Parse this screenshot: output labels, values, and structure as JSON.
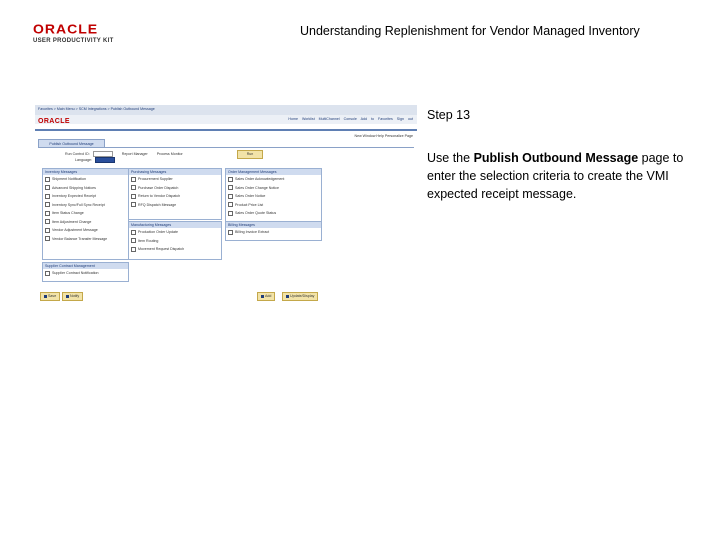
{
  "header": {
    "logo_oracle": "ORACLE",
    "logo_upk": "USER PRODUCTIVITY KIT",
    "title": "Understanding Replenishment for Vendor Managed Inventory"
  },
  "step": {
    "label": "Step 13"
  },
  "instruction": {
    "prefix": "Use the ",
    "bold": "Publish Outbound Message",
    "suffix": " page to enter the selection criteria to create the VMI expected receipt message."
  },
  "screenshot": {
    "breadcrumb": "Favorites  >  Main Menu  >  SCM Integrations  >  Publish Outbound Message",
    "nav_links": "Home   Worklist   MultiChannel Console   Add to Favorites   Sign out",
    "logo": "ORACLE",
    "util_links": "New Window  Help  Personalize Page",
    "tab_label": "Publish Outbound Message",
    "run_control_label": "Run Control ID:",
    "run_control_value": "1",
    "language_label": "Language:",
    "report_manager": "Report Manager",
    "process_monitor": "Process Monitor",
    "run_button": "Run",
    "boxes": {
      "inventory": {
        "header": "Inventory Messages",
        "items": [
          "Shipment Notification",
          "Advanced Shipping Notices",
          "Inventory Expected Receipt",
          "Inventory Sync/Full Sync Receipt",
          "Item Status Change",
          "Item Adjustment Change",
          "Vendor Adjustment Message",
          "Vendor Balance Transfer Message"
        ]
      },
      "purchasing": {
        "header": "Purchasing Messages",
        "items": [
          "Procurement Supplier",
          "Purchase Order Dispatch",
          "Return to Vendor Dispatch",
          "RFQ Dispatch Message"
        ]
      },
      "order": {
        "header": "Order Management Messages",
        "items": [
          "Sales Order Acknowledgement",
          "Sales Order Change Notice",
          "Sales Order Notice",
          "Product Price List",
          "Sales Order Quote Status"
        ]
      },
      "manufacturing": {
        "header": "Manufacturing Messages",
        "items": [
          "Production Order Update",
          "Item Routing",
          "Movement Request Dispatch"
        ]
      },
      "billing": {
        "header": "Billing Messages",
        "items": [
          "Billing Invoice Extract"
        ]
      },
      "supplier": {
        "header": "Supplier Contract Management",
        "items": [
          "Supplier Contract Notification"
        ]
      }
    },
    "buttons": {
      "save": "Save",
      "notify": "Notify",
      "add": "Add",
      "update_display": "Update/Display"
    }
  }
}
